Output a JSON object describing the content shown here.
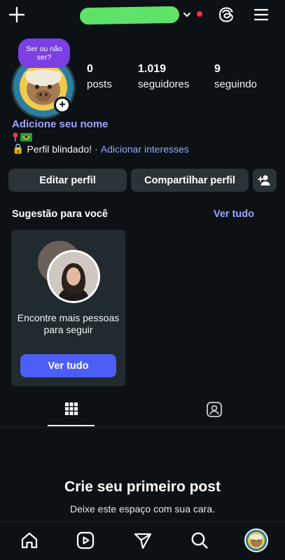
{
  "header": {
    "menu_aria": "Menu"
  },
  "note": {
    "text": "Ser ou não ser?"
  },
  "stats": [
    {
      "value": "0",
      "label": "posts"
    },
    {
      "value": "1.019",
      "label": "seguidores"
    },
    {
      "value": "9",
      "label": "seguindo"
    }
  ],
  "profile": {
    "add_name": "Adicione seu nome",
    "bio_lock": "🔒",
    "bio_text": "Perfil blindado!",
    "bio_sep": "·",
    "add_interests": "Adicionar interesses"
  },
  "actions": {
    "edit": "Editar perfil",
    "share": "Compartilhar perfil"
  },
  "suggestions": {
    "title": "Sugestão para você",
    "see_all": "Ver tudo",
    "card_text": "Encontre mais pessoas para seguir",
    "card_button": "Ver tudo"
  },
  "empty": {
    "title": "Crie seu primeiro post",
    "subtitle": "Deixe este espaço com sua cara."
  },
  "colors": {
    "accent_link": "#9fa4ff",
    "primary_button": "#4c5ef5",
    "note_bubble": "#7b3fe4",
    "notification_dot": "#ff2d46"
  }
}
